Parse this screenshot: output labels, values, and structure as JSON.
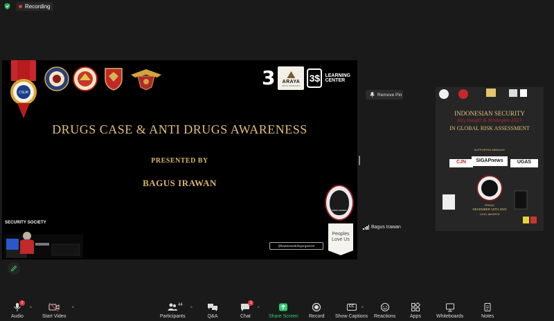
{
  "status": {
    "recording_label": "Recording",
    "colors": {
      "recording_dot": "#e0393e",
      "shield": "#24b35a"
    }
  },
  "main_share": {
    "slide": {
      "title": "DRUGS CASE & ANTI DRUGS AWARENESS",
      "presented_by": "PRESENTED BY",
      "presenter": "BAGUS IRAWAN",
      "colors": {
        "gold": "#e2c07a",
        "background": "#000000"
      }
    },
    "logos": {
      "left_seals": [
        "cslm-medal-icon",
        "police-seal-icon",
        "lemhannas-seal-icon",
        "army-shield-icon",
        "eagle-crest-icon"
      ],
      "brand_3": "3",
      "araya_name": "ARAYA",
      "araya_sub": "ARYA PERSADA",
      "lc_box": "3$",
      "lc_line1": "LEARNING",
      "lc_line2": "CENTER"
    },
    "security_society": "SECURITY SOCIETY",
    "medal_caption": "SPEAK LEADERS",
    "peoples_love_us_1": "Peoples",
    "peoples_love_us_2": "Love Us",
    "kawan_tag": "@kawanweddingorganizer"
  },
  "side": {
    "remove_pin_label": "Remove Pin",
    "participant_name": "Bagus Irawan",
    "poster": {
      "headline_1": "INDONESIAN SECURITY",
      "headline_script": "Key Insight & Strategies 2023",
      "headline_2": "IN GLOBAL RISK ASSESSMENT",
      "supported_by": "SUPPORTED MEDIA BY",
      "sponsor_1": "CJN",
      "sponsor_2": "SIGAPnews",
      "sponsor_3": "UGAS",
      "event_day": "FRIDAY",
      "event_date": "DECEMBER 15TH 2023",
      "event_time": "13:00 JAKARTA"
    }
  },
  "toolbar": {
    "audio": "Audio",
    "start_video": "Start Video",
    "participants": "Participants",
    "participants_count": "44",
    "qa": "Q&A",
    "chat": "Chat",
    "chat_badge": "1",
    "audio_badge": "1",
    "share_screen": "Share Screen",
    "record": "Record",
    "show_captions": "Show Captions",
    "cc": "CC",
    "reactions": "Reactions",
    "apps": "Apps",
    "whiteboards": "Whiteboards",
    "notes": "Notes",
    "colors": {
      "share_green": "#2ecc71",
      "badge_red": "#e0393e"
    }
  }
}
